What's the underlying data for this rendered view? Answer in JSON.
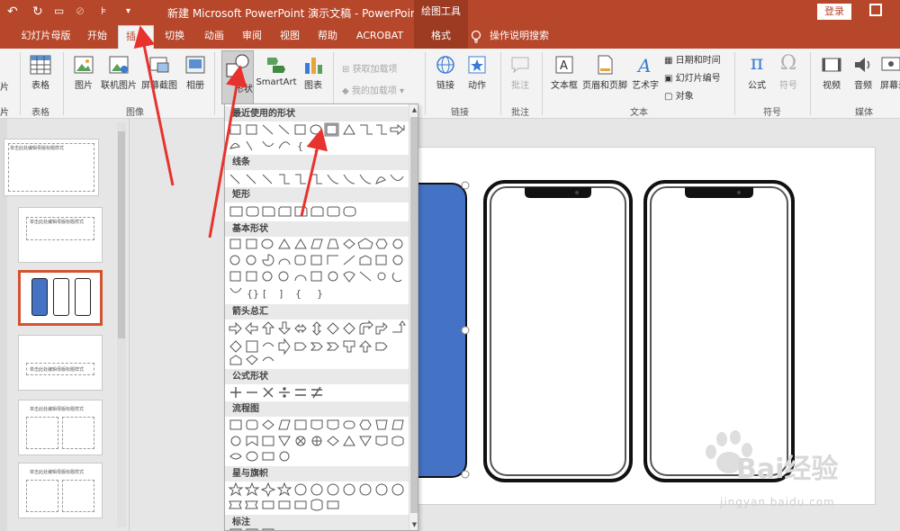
{
  "titlebar": {
    "doc_title": "新建 Microsoft PowerPoint 演示文稿 - PowerPoint",
    "context_tools": "绘图工具",
    "login": "登录"
  },
  "tabs": [
    "幻灯片母版",
    "开始",
    "插入",
    "切换",
    "动画",
    "审阅",
    "视图",
    "帮助",
    "ACROBAT",
    "格式",
    "操作说明搜索"
  ],
  "active_tab": "插入",
  "ribbon": {
    "table_label": "表格",
    "table_group": "表格",
    "picture": "图片",
    "online_picture": "联机图片",
    "screenshot": "屏幕截图",
    "album": "相册",
    "image_group": "图像",
    "shapes": "形状",
    "smartart": "SmartArt",
    "chart": "图表",
    "get_addins": "获取加载项",
    "my_addins": "我的加载项",
    "link": "链接",
    "action": "动作",
    "link_group": "链接",
    "comment": "批注",
    "comment_group": "批注",
    "textbox": "文本框",
    "header_footer": "页眉和页脚",
    "wordart": "艺术字",
    "date_time": "日期和时间",
    "slide_number": "幻灯片编号",
    "object": "对象",
    "text_group": "文本",
    "equation": "公式",
    "symbol": "符号",
    "symbol_group": "符号",
    "video": "视频",
    "audio": "音频",
    "screen_record": "屏幕录制",
    "media_group": "媒体",
    "left_cut_1": "片",
    "left_cut_2": "片"
  },
  "thumbnails": [
    {
      "text": "单击此处编辑母版标题样式"
    },
    {
      "text": "单击此处编辑母版标题样式"
    },
    {
      "text": ""
    },
    {
      "text": "单击此处编辑母版标题样式"
    },
    {
      "text": "单击此处编辑母版标题样式"
    },
    {
      "text": "单击此处编辑母版标题样式"
    }
  ],
  "shapes_menu": {
    "sections": [
      "最近使用的形状",
      "线条",
      "矩形",
      "基本形状",
      "箭头总汇",
      "公式形状",
      "流程图",
      "星与旗帜",
      "标注"
    ]
  },
  "watermark": {
    "brand": "Bai经验",
    "site": "jingyan.baidu.com"
  },
  "colors": {
    "accent": "#b7472a",
    "phone_blue": "#4472c4",
    "arrow_red": "#e8322d"
  }
}
